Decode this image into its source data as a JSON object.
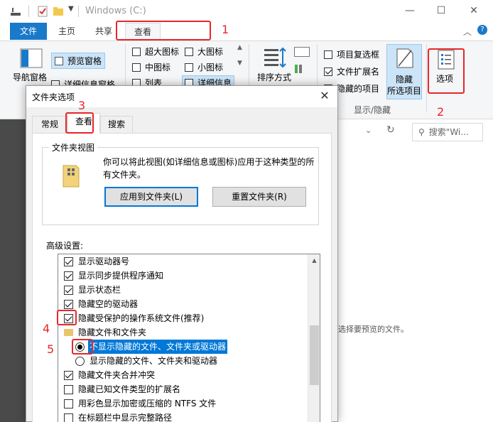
{
  "window": {
    "title": "Windows (C:)",
    "minimize": "—",
    "maximize": "☐",
    "close": "✕"
  },
  "ribbon_tabs": {
    "file": "文件",
    "home": "主页",
    "share": "共享",
    "view": "查看"
  },
  "ribbon": {
    "nav_pane": "导航窗格",
    "preview_pane": "预览窗格",
    "details_pane": "详细信息窗格",
    "extra_large_icons": "超大图标",
    "large_icons": "大图标",
    "medium_icons": "中图标",
    "small_icons": "小图标",
    "list": "列表",
    "details": "详细信息",
    "sort_by": "排序方式",
    "item_checkboxes": "项目复选框",
    "file_extensions": "文件扩展名",
    "hidden_items": "隐藏的项目",
    "hide_selected_1": "隐藏",
    "hide_selected_2": "所选项目",
    "options": "选项",
    "group_show_hide": "显示/隐藏"
  },
  "search_placeholder": "搜索\"Wi...",
  "preview_message": "选择要预览的文件。",
  "dialog": {
    "title": "文件夹选项",
    "tabs": {
      "general": "常规",
      "view": "查看",
      "search": "搜索"
    },
    "folder_views_label": "文件夹视图",
    "folder_views_desc": "你可以将此视图(如详细信息或图标)应用于这种类型的所有文件夹。",
    "apply_button": "应用到文件夹(L)",
    "reset_button": "重置文件夹(R)",
    "advanced_label": "高级设置:",
    "rows": [
      {
        "text": "显示驱动器号",
        "kind": "checkbox",
        "checked": true
      },
      {
        "text": "显示同步提供程序通知",
        "kind": "checkbox",
        "checked": true
      },
      {
        "text": "显示状态栏",
        "kind": "checkbox",
        "checked": true
      },
      {
        "text": "隐藏空的驱动器",
        "kind": "checkbox",
        "checked": true
      },
      {
        "text": "隐藏受保护的操作系统文件(推荐)",
        "kind": "checkbox",
        "checked": true
      },
      {
        "text": "隐藏文件和文件夹",
        "kind": "folder"
      },
      {
        "text": "不显示隐藏的文件、文件夹或驱动器",
        "kind": "radio",
        "checked": true
      },
      {
        "text": "显示隐藏的文件、文件夹和驱动器",
        "kind": "radio",
        "checked": false
      },
      {
        "text": "隐藏文件夹合并冲突",
        "kind": "checkbox",
        "checked": true
      },
      {
        "text": "隐藏已知文件类型的扩展名",
        "kind": "checkbox",
        "checked": false
      },
      {
        "text": "用彩色显示加密或压缩的 NTFS 文件",
        "kind": "checkbox",
        "checked": false
      },
      {
        "text": "在标题栏中显示完整路径",
        "kind": "checkbox",
        "checked": false
      }
    ]
  },
  "annotations": [
    "1",
    "2",
    "3",
    "4",
    "5"
  ],
  "colors": {
    "accent": "#1979ca",
    "selection": "#0078d7",
    "annotation": "#e8262a"
  }
}
